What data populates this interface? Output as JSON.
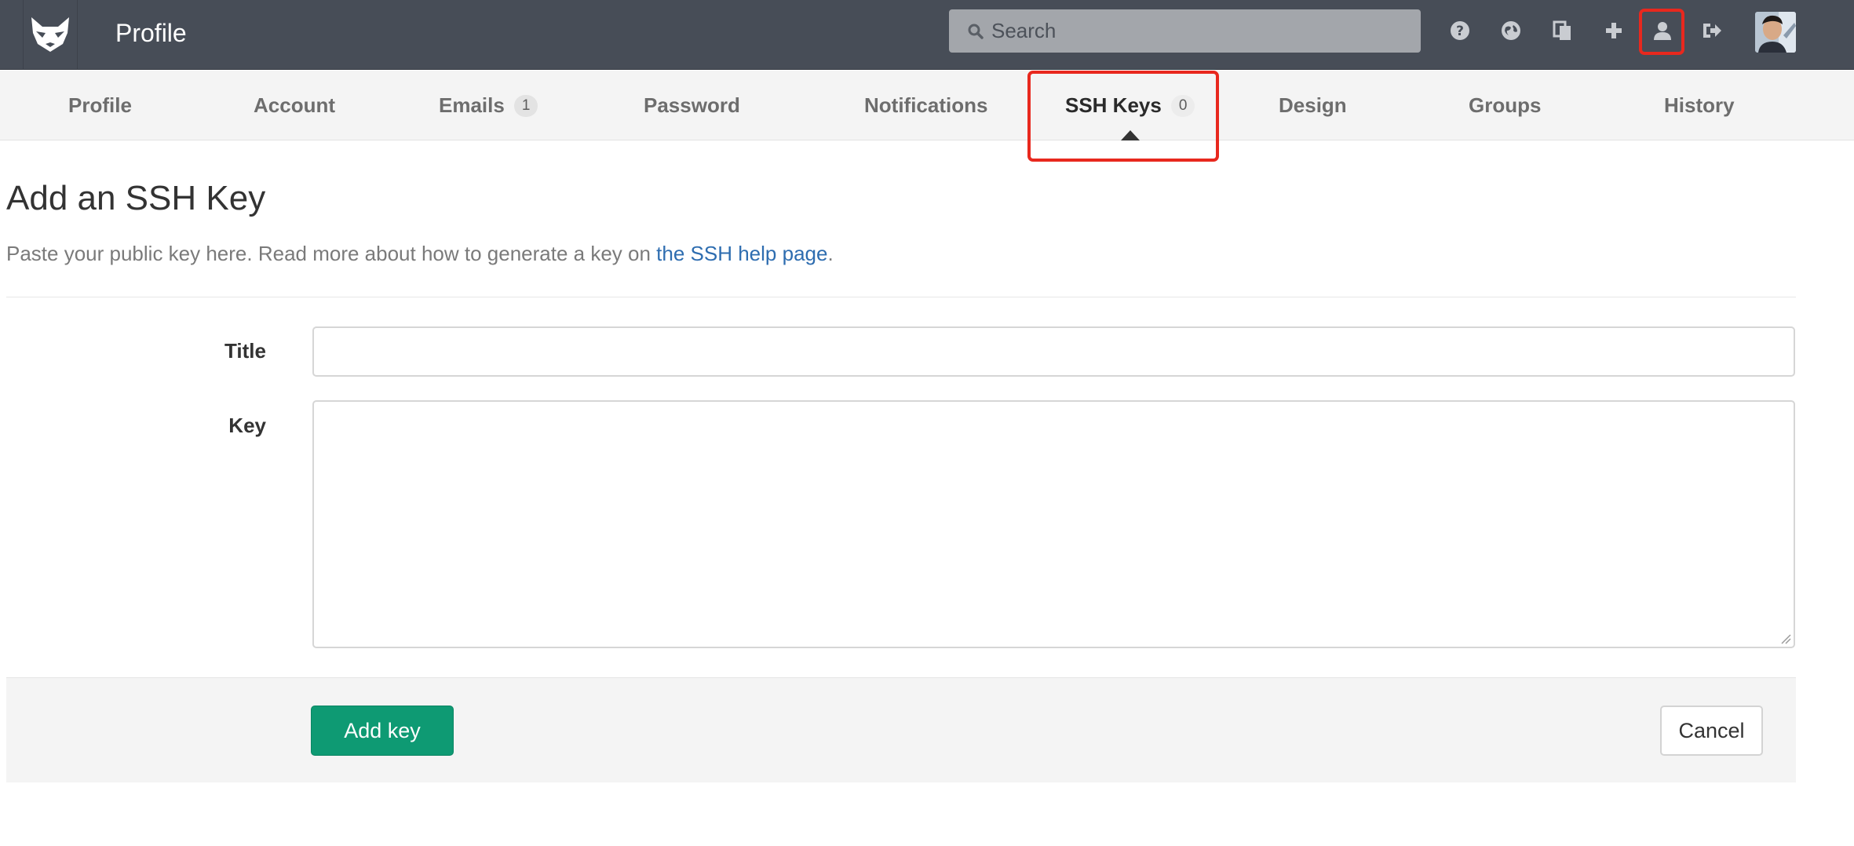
{
  "header": {
    "title": "Profile",
    "search_placeholder": "Search",
    "icons": [
      "help-icon",
      "explore-globe-icon",
      "snippets-icon",
      "new-project-plus-icon",
      "profile-user-icon",
      "logout-icon"
    ]
  },
  "nav": {
    "tabs": [
      {
        "label": "Profile"
      },
      {
        "label": "Account"
      },
      {
        "label": "Emails",
        "badge": "1"
      },
      {
        "label": "Password"
      },
      {
        "label": "Notifications"
      },
      {
        "label": "SSH Keys",
        "badge": "0",
        "active": true
      },
      {
        "label": "Design"
      },
      {
        "label": "Groups"
      },
      {
        "label": "History"
      }
    ]
  },
  "main": {
    "heading": "Add an SSH Key",
    "lead_text": "Paste your public key here. Read more about how to generate a key on ",
    "lead_link": "the SSH help page",
    "lead_end": ".",
    "form": {
      "title_label": "Title",
      "title_value": "",
      "key_label": "Key",
      "key_value": ""
    },
    "actions": {
      "submit_label": "Add key",
      "cancel_label": "Cancel"
    }
  },
  "colors": {
    "header_bg": "#474d57",
    "nav_bg": "#f4f4f4",
    "primary_button": "#0e9a73",
    "link": "#2e6db0",
    "highlight": "#e8281e"
  }
}
